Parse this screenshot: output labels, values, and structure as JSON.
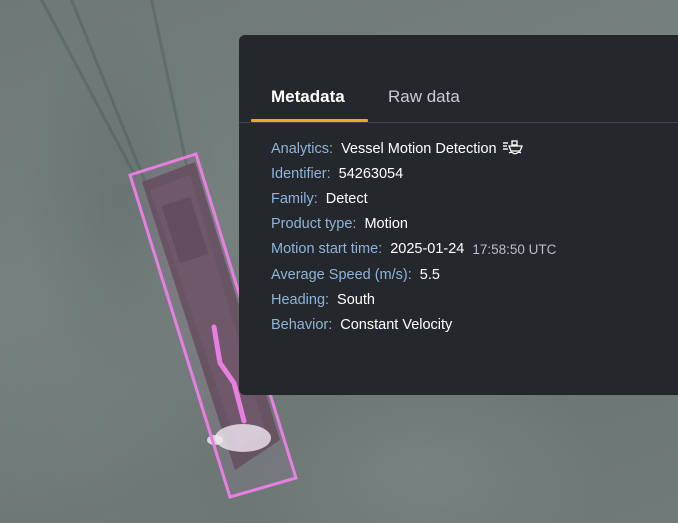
{
  "map": {
    "description_icon": "satellite-imagery"
  },
  "overlay": {
    "highlight_color": "#e87fe0"
  },
  "panel": {
    "tabs": [
      {
        "label": "Metadata",
        "active": true
      },
      {
        "label": "Raw data",
        "active": false
      }
    ],
    "accent_color": "#f0a623",
    "fields": {
      "analytics": {
        "label": "Analytics:",
        "value": "Vessel Motion Detection",
        "icon": "ship-motion-icon"
      },
      "identifier": {
        "label": "Identifier:",
        "value": "54263054"
      },
      "family": {
        "label": "Family:",
        "value": "Detect"
      },
      "product_type": {
        "label": "Product type:",
        "value": "Motion"
      },
      "motion_start_time": {
        "label": "Motion start time:",
        "date": "2025-01-24",
        "time": "17:58:50 UTC"
      },
      "average_speed": {
        "label": "Average Speed (m/s):",
        "value": "5.5"
      },
      "heading": {
        "label": "Heading:",
        "value": "South"
      },
      "behavior": {
        "label": "Behavior:",
        "value": "Constant Velocity"
      }
    }
  }
}
